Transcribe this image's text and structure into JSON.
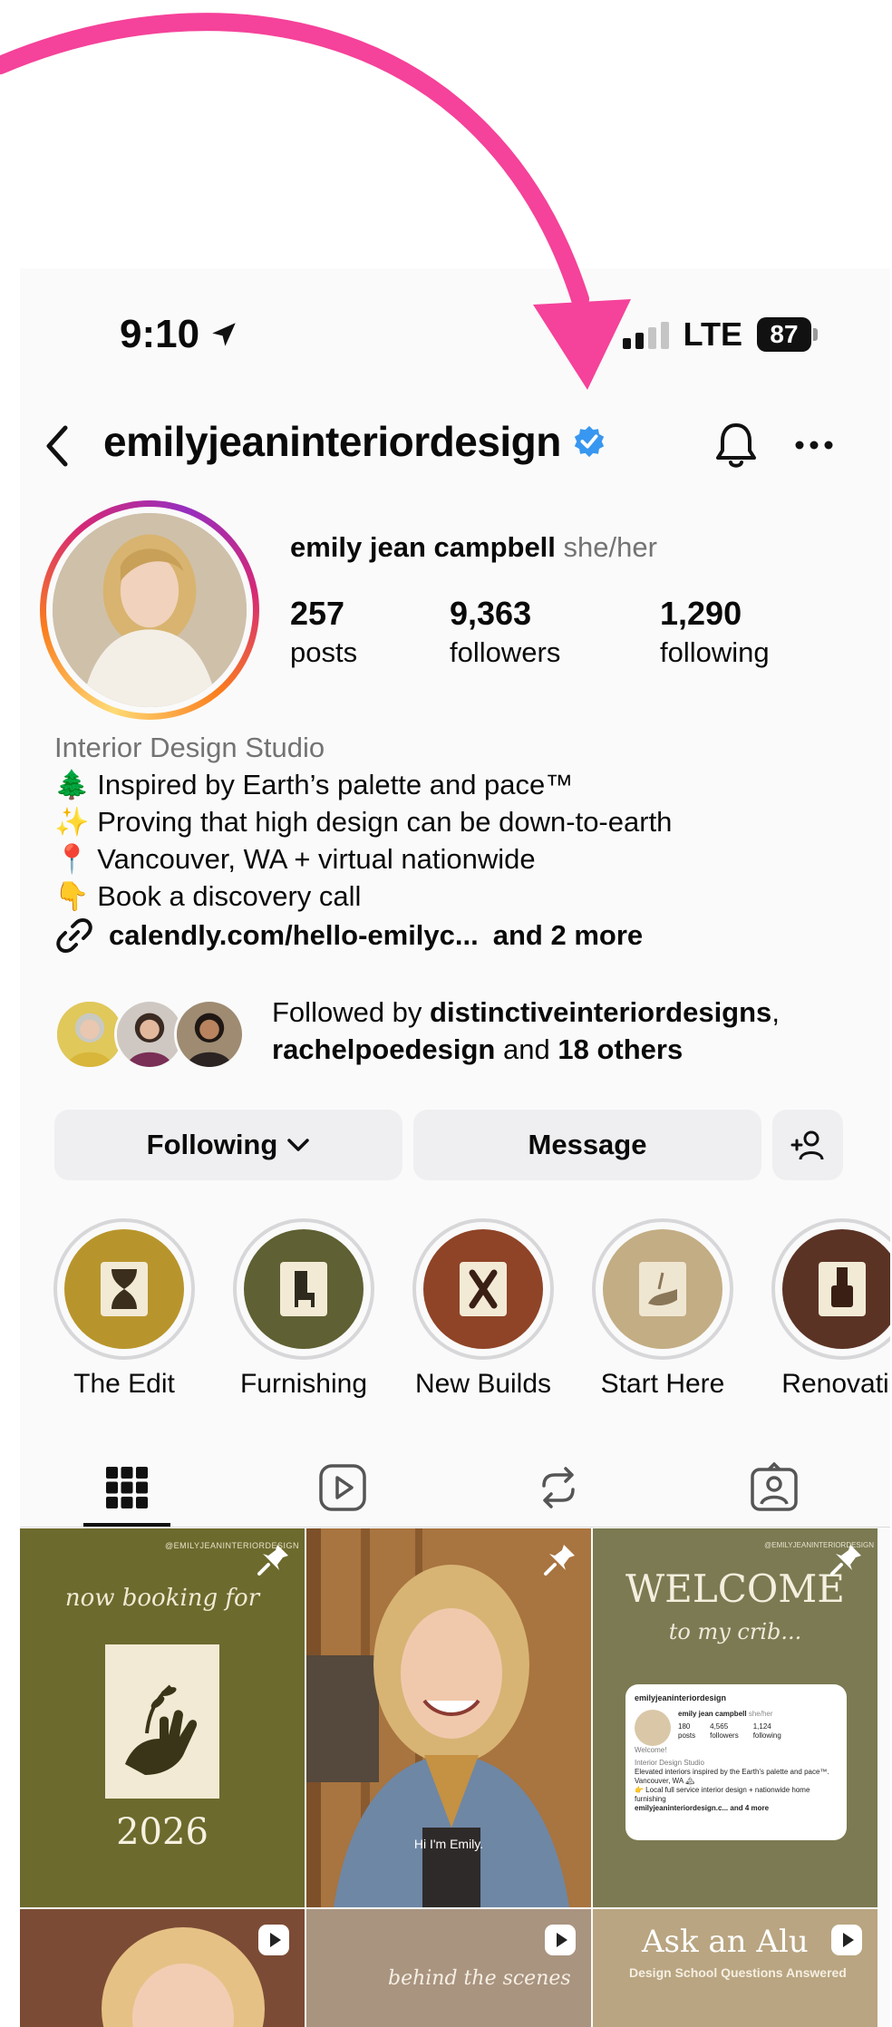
{
  "status": {
    "time": "9:10",
    "network": "LTE",
    "battery": "87"
  },
  "header": {
    "username": "emilyjeaninteriordesign"
  },
  "profile": {
    "name": "emily jean campbell",
    "pronouns": "she/her",
    "stats": [
      {
        "value": "257",
        "label": "posts"
      },
      {
        "value": "9,363",
        "label": "followers"
      },
      {
        "value": "1,290",
        "label": "following"
      }
    ]
  },
  "bio": {
    "category": "Interior Design Studio",
    "lines": [
      {
        "emoji": "🌲",
        "text": "Inspired by Earth’s palette and pace™"
      },
      {
        "emoji": "✨",
        "text": "Proving that high design can be down-to-earth"
      },
      {
        "emoji": "📍",
        "text": "Vancouver, WA + virtual nationwide"
      },
      {
        "emoji": "👇",
        "text": "Book a discovery call"
      }
    ],
    "link": "calendly.com/hello-emilyc...",
    "link_more": "and 2 more"
  },
  "followed_by": {
    "prefix": "Followed by",
    "user1": "distinctiveinteriordesigns",
    "comma": ",",
    "user2": "rachelpoedesign",
    "and": "and",
    "others": "18 others"
  },
  "actions": {
    "following": "Following",
    "message": "Message"
  },
  "highlights": [
    {
      "label": "The Edit",
      "color": "#b8952c"
    },
    {
      "label": "Furnishing",
      "color": "#5f6033"
    },
    {
      "label": "New Builds",
      "color": "#8f4427"
    },
    {
      "label": "Start Here",
      "color": "#c3ad84"
    },
    {
      "label": "Renovatic",
      "color": "#5b3325"
    }
  ],
  "posts": {
    "p1": {
      "watermark": "@EMILYJEANINTERIORDESIGN",
      "script": "now booking for",
      "year": "2026"
    },
    "p2": {
      "caption": "Hi I'm Emily."
    },
    "p3": {
      "watermark": "@EMILYJEANINTERIORDESIGN",
      "title": "WELCOME",
      "script": "to my crib...",
      "mini_user": "emilyjeaninteriordesign",
      "mini_name": "emily jean campbell",
      "mini_pronouns": "she/her",
      "mini_stats": [
        "180",
        "4,565",
        "1,124"
      ],
      "mini_stat_labels": [
        "posts",
        "followers",
        "following"
      ],
      "mini_welcome": "Welcome!",
      "mini_bio1": "Interior Design Studio",
      "mini_bio2": "Elevated interiors inspired by the Earth’s palette and pace™.",
      "mini_bio3": "Vancouver, WA 🏔",
      "mini_bio4": "👉 Local full service interior design + nationwide home furnishing",
      "mini_link": "emilyjeaninteriordesign.c...",
      "mini_link_more": "and 4 more"
    },
    "p5": {
      "script": "behind the scenes"
    },
    "p6": {
      "title": "Ask an Alu",
      "subtitle": "Design School Questions Answered"
    }
  },
  "colors": {
    "accent_arrow": "#f5429a",
    "verified": "#3897f0",
    "button_bg": "#efeff2"
  }
}
